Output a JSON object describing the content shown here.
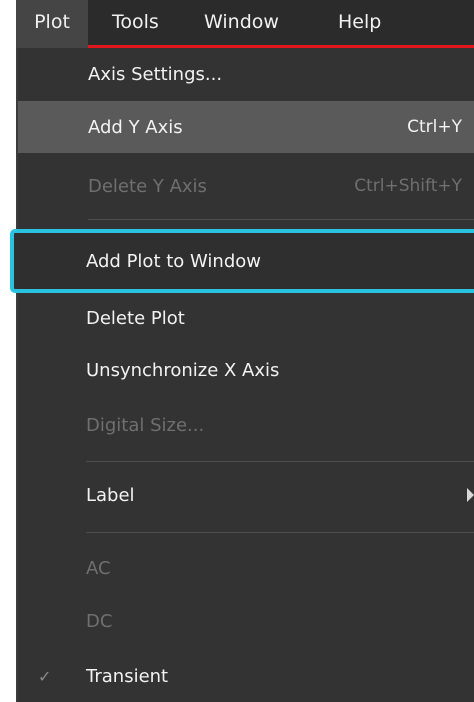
{
  "menubar": {
    "items": [
      {
        "label": "Plot",
        "active": true
      },
      {
        "label": "Tools"
      },
      {
        "label": "Window"
      },
      {
        "label": "Help"
      }
    ]
  },
  "dropdown": {
    "items": [
      {
        "label": "Axis Settings...",
        "shortcut": "",
        "enabled": true
      },
      {
        "label": "Add Y Axis",
        "shortcut": "Ctrl+Y",
        "enabled": true,
        "hovered": true
      },
      {
        "label": "Delete Y Axis",
        "shortcut": "Ctrl+Shift+Y",
        "enabled": false
      },
      {
        "label": "Add Plot to Window",
        "shortcut": "",
        "enabled": true,
        "highlighted": true
      },
      {
        "label": "Delete Plot",
        "shortcut": "",
        "enabled": true
      },
      {
        "label": "Unsynchronize X Axis",
        "shortcut": "",
        "enabled": true
      },
      {
        "label": "Digital Size...",
        "shortcut": "",
        "enabled": false
      },
      {
        "label": "Label",
        "shortcut": "",
        "enabled": true,
        "submenu": true
      },
      {
        "label": "AC",
        "shortcut": "",
        "enabled": false
      },
      {
        "label": "DC",
        "shortcut": "",
        "enabled": false
      },
      {
        "label": "Transient",
        "shortcut": "",
        "enabled": true,
        "checked": true
      }
    ]
  },
  "icons": {
    "submenu_arrow": "chevron-right-icon",
    "check": "check-icon"
  },
  "colors": {
    "menu_background": "#333333",
    "menubar_accent": "#e0161e",
    "highlight_outline": "#29c2e0",
    "hover_background": "#5a5a5a",
    "disabled_text": "#6f6f6f"
  }
}
